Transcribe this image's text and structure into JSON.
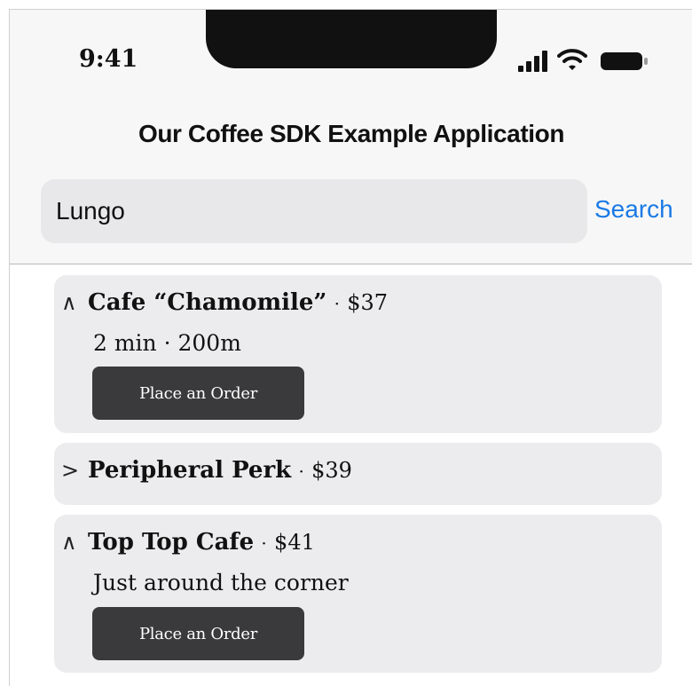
{
  "status_bar": {
    "time": "9:41",
    "icons": [
      "signal-icon",
      "wifi-icon",
      "battery-icon"
    ]
  },
  "header": {
    "title": "Our Coffee SDK Example Application"
  },
  "search": {
    "value": "Lungo",
    "button_label": "Search"
  },
  "cafes": [
    {
      "chevron": "∧",
      "name": "Cafe “Chamomile”",
      "separator": "·",
      "price": "$37",
      "expanded": true,
      "detail": "2 min · 200m",
      "order_label": "Place an Order"
    },
    {
      "chevron": ">",
      "name": "Peripheral Perk",
      "separator": "·",
      "price": "$39",
      "expanded": false
    },
    {
      "chevron": "∧",
      "name": "Top Top Cafe",
      "separator": "·",
      "price": "$41",
      "expanded": true,
      "detail": "Just around the corner",
      "order_label": "Place an Order"
    }
  ],
  "colors": {
    "accent": "#1a7ae6",
    "card_background": "#ececee",
    "button_background": "#3a3a3c",
    "header_background": "#f7f7f7"
  }
}
